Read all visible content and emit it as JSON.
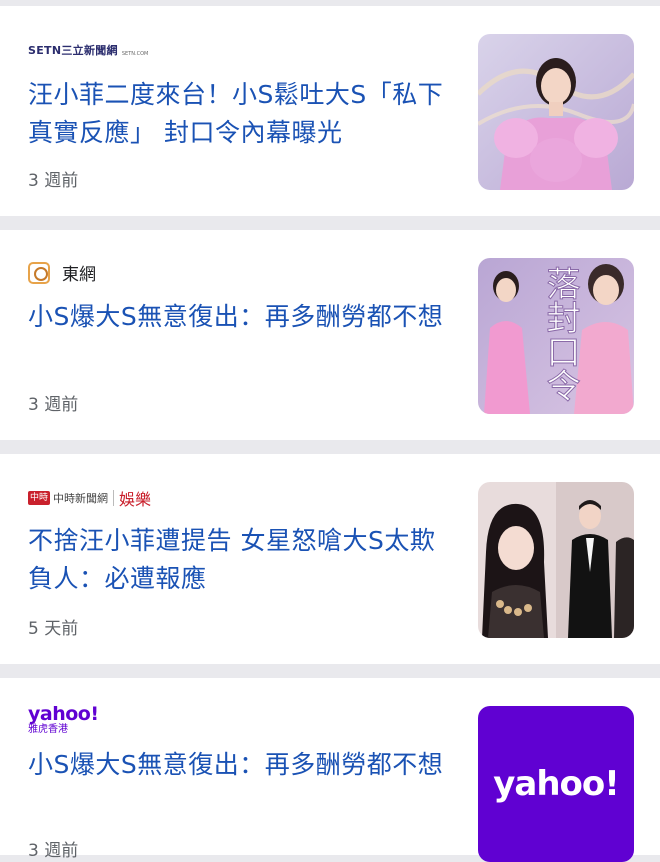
{
  "articles": [
    {
      "source": "SETN三立新聞網",
      "source_sub": "SETN.COM",
      "headline": "汪小菲二度來台！小S鬆吐大S「私下真實反應」 封口令內幕曝光",
      "time": "3 週前",
      "thumb_icon": "woman-in-pink-dress-photo"
    },
    {
      "source": "東網",
      "headline": "小S爆大S無意復出：再多酬勞都不想",
      "time": "3 週前",
      "thumb_caption": "落封口令",
      "thumb_icon": "two-women-in-pink-photo"
    },
    {
      "source": "中時新聞網",
      "source_sub": "娛樂",
      "headline": "不捨汪小菲遭提告 女星怒嗆大S太欺負人：必遭報應",
      "time": "5 天前",
      "thumb_icon": "woman-and-man-in-suit-photo"
    },
    {
      "source": "yahoo!",
      "source_sub": "雅虎香港",
      "headline": "小S爆大S無意復出：再多酬勞都不想",
      "time": "3 週前",
      "thumb_logo": "yahoo!",
      "thumb_icon": "yahoo-logo"
    }
  ],
  "colors": {
    "headline": "#1a52b4",
    "yahoo_purple": "#6001d2",
    "divider": "#e9e9ed"
  }
}
